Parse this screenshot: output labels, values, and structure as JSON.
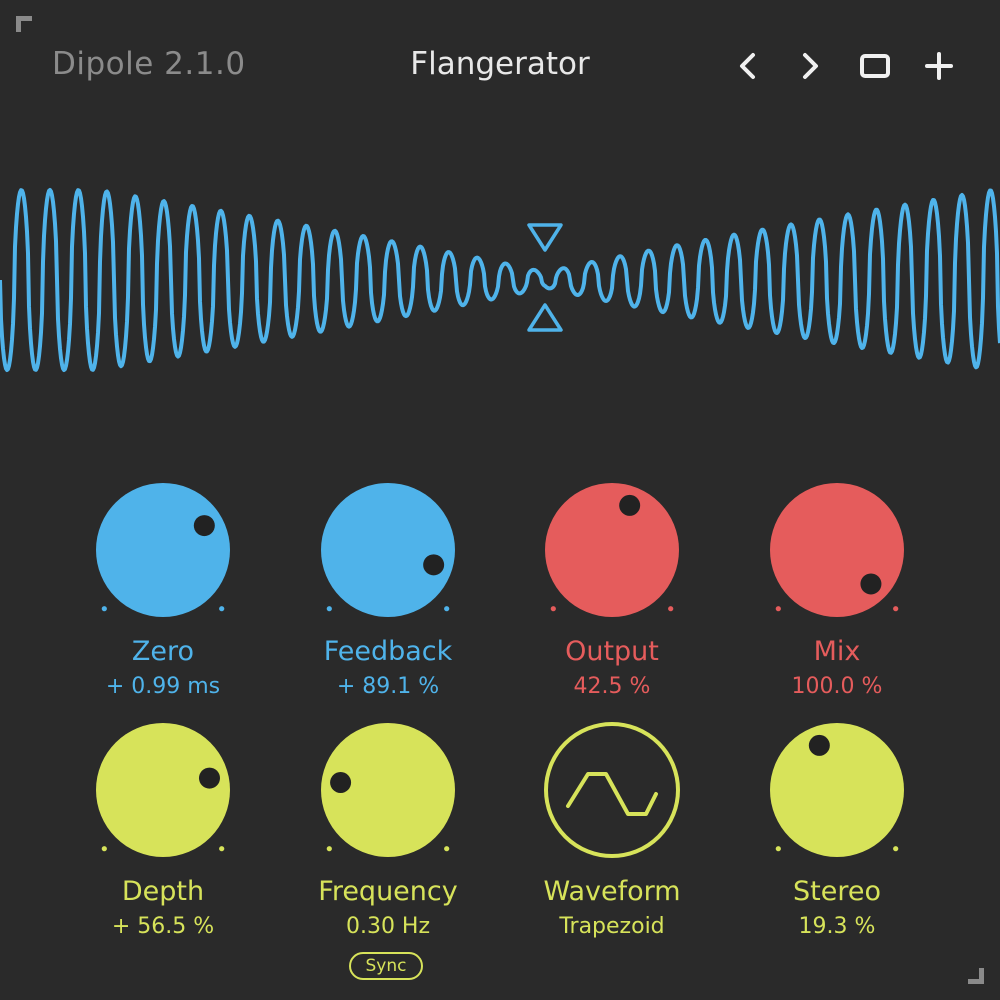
{
  "header": {
    "app_title": "Dipole 2.1.0",
    "preset_name": "Flangerator",
    "buttons": [
      {
        "name": "prev-preset-button",
        "icon": "chevron-left-icon"
      },
      {
        "name": "next-preset-button",
        "icon": "chevron-right-icon"
      },
      {
        "name": "window-button",
        "icon": "square-icon"
      },
      {
        "name": "add-button",
        "icon": "plus-icon"
      }
    ]
  },
  "colors": {
    "background": "#2a2a2a",
    "blue": "#4fb3ea",
    "red": "#e55c5c",
    "yellow": "#d7e35a"
  },
  "knobs": [
    {
      "id": "zero",
      "label": "Zero",
      "value": "+ 0.99 ms",
      "color": "blue",
      "level": 0.72
    },
    {
      "id": "feedback",
      "label": "Feedback",
      "value": "+ 89.1 %",
      "color": "blue",
      "level": 0.9
    },
    {
      "id": "output",
      "label": "Output",
      "value": "42.5 %",
      "color": "red",
      "level": 0.58
    },
    {
      "id": "mix",
      "label": "Mix",
      "value": "100.0 %",
      "color": "red",
      "level": 1.0
    },
    {
      "id": "depth",
      "label": "Depth",
      "value": "+ 56.5 %",
      "color": "yellow",
      "level": 0.78
    },
    {
      "id": "frequency",
      "label": "Frequency",
      "value": "0.30 Hz",
      "color": "yellow",
      "level": 0.2
    },
    {
      "id": "waveform",
      "label": "Waveform",
      "value": "Trapezoid",
      "color": "yellow",
      "type": "selector"
    },
    {
      "id": "stereo",
      "label": "Stereo",
      "value": "19.3 %",
      "color": "yellow",
      "level": 0.42
    }
  ],
  "sync": {
    "label": "Sync"
  }
}
